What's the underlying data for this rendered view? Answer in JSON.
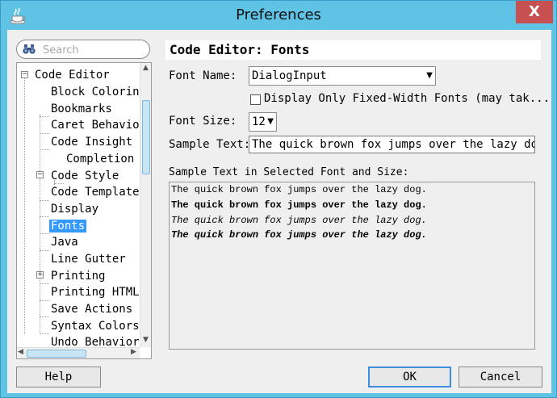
{
  "window": {
    "title": "Preferences",
    "close_glyph": "X"
  },
  "search": {
    "placeholder": "Search"
  },
  "tree": {
    "items": [
      {
        "label": "Code Editor"
      },
      {
        "label": "Block Coloring"
      },
      {
        "label": "Bookmarks"
      },
      {
        "label": "Caret Behavior"
      },
      {
        "label": "Code Insight"
      },
      {
        "label": "Completion"
      },
      {
        "label": "Code Style"
      },
      {
        "label": "Code Templates"
      },
      {
        "label": "Display"
      },
      {
        "label": "Fonts"
      },
      {
        "label": "Java"
      },
      {
        "label": "Line Gutter"
      },
      {
        "label": "Printing"
      },
      {
        "label": "Printing HTML"
      },
      {
        "label": "Save Actions"
      },
      {
        "label": "Syntax Colors"
      },
      {
        "label": "Undo Behavior"
      }
    ],
    "selected": "Fonts"
  },
  "panel": {
    "header": "Code Editor: Fonts",
    "font_name_label": "Font Name:",
    "font_name_value": "DialogInput",
    "fixed_width_label": "Display Only Fixed-Width Fonts (may tak...",
    "fixed_width_checked": false,
    "font_size_label": "Font Size:",
    "font_size_value": "12",
    "sample_text_label": "Sample Text:",
    "sample_text_value": "The quick brown fox jumps over the lazy dog.",
    "preview_label": "Sample Text in Selected Font and Size:",
    "preview_lines": [
      "The quick brown fox jumps over the lazy dog.",
      "The quick brown fox jumps over the lazy dog.",
      "The quick brown fox jumps over the lazy dog.",
      "The quick brown fox jumps over the lazy dog."
    ]
  },
  "buttons": {
    "help": "Help",
    "ok": "OK",
    "cancel": "Cancel"
  },
  "colors": {
    "title_bar": "#5fc3e6",
    "close_button": "#c75050",
    "selection": "#3399ff",
    "default_button_border": "#3d8ede"
  }
}
